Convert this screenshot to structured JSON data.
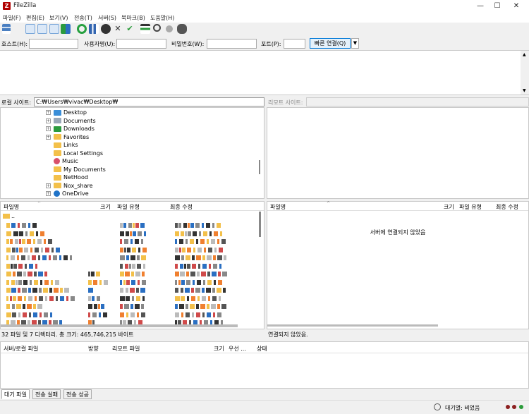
{
  "window": {
    "title": "FileZilla",
    "minimize": "—",
    "maximize": "☐",
    "close": "✕"
  },
  "menu": [
    "파일(F)",
    "편집(E)",
    "보기(V)",
    "전송(T)",
    "서버(S)",
    "북마크(B)",
    "도움말(H)"
  ],
  "quickconnect": {
    "host_label": "호스트(H):",
    "host_value": "",
    "user_label": "사용자명(U):",
    "user_value": "",
    "pass_label": "비밀번호(W):",
    "pass_value": "",
    "port_label": "포트(P):",
    "port_value": "",
    "button": "빠른 연결(Q)"
  },
  "local": {
    "site_label": "로컬 사이트:",
    "path": "C:₩Users₩vivac₩Desktop₩",
    "tree": [
      {
        "name": "Desktop",
        "icon": "desktop-folder-icon",
        "expander": "+"
      },
      {
        "name": "Documents",
        "icon": "documents-folder-icon",
        "expander": "+"
      },
      {
        "name": "Downloads",
        "icon": "downloads-folder-icon",
        "expander": "+"
      },
      {
        "name": "Favorites",
        "icon": "folder-icon",
        "expander": "+"
      },
      {
        "name": "Links",
        "icon": "folder-icon",
        "expander": ""
      },
      {
        "name": "Local Settings",
        "icon": "folder-icon",
        "expander": ""
      },
      {
        "name": "Music",
        "icon": "music-folder-icon",
        "expander": ""
      },
      {
        "name": "My Documents",
        "icon": "folder-icon",
        "expander": ""
      },
      {
        "name": "NetHood",
        "icon": "folder-icon",
        "expander": ""
      },
      {
        "name": "Nox_share",
        "icon": "folder-icon",
        "expander": "+"
      },
      {
        "name": "OneDrive",
        "icon": "onedrive-icon",
        "expander": "+"
      }
    ],
    "columns": [
      "파일명",
      "크기",
      "파일 유형",
      "최종 수정"
    ],
    "parent_dir": "..",
    "status": "32 파일 및 7 디렉터리. 총 크기: 465,746,215 바이트"
  },
  "remote": {
    "site_label": "리모트 사이트:",
    "path": "",
    "columns": [
      "파일명",
      "크기",
      "파일 유형",
      "최종 수정"
    ],
    "message": "서버에 연결되지 않았음",
    "status": "연결되지 않았음."
  },
  "queue": {
    "columns": [
      "서버/로컬 파일",
      "방향",
      "리모트 파일",
      "크기",
      "우선 ...",
      "상태"
    ]
  },
  "tabs": [
    "대기 파일",
    "전송 실패",
    "전송 성공"
  ],
  "statusbar": {
    "queue": "대기열: 비었음"
  },
  "colors": {
    "accent": "#0078d7",
    "folder": "#f3c04a",
    "brand_red": "#b00000"
  }
}
